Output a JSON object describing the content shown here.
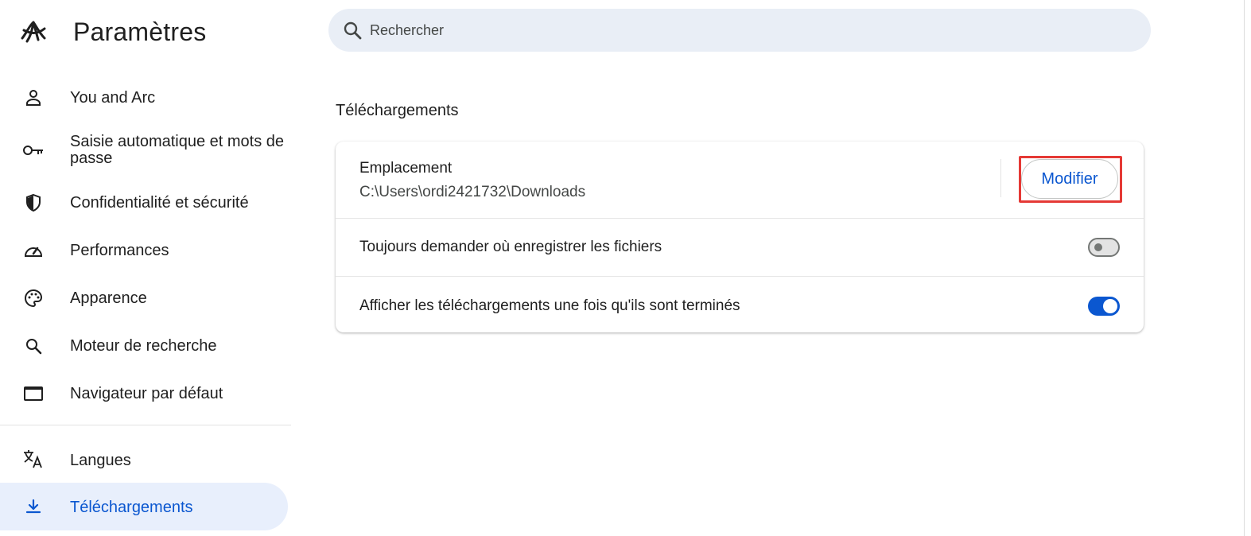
{
  "app": {
    "title": "Paramètres",
    "logo_icon": "arc-logo-icon"
  },
  "search": {
    "placeholder": "Rechercher",
    "icon": "search-icon"
  },
  "sidebar": {
    "items": [
      {
        "label": "You and Arc",
        "icon": "person-icon",
        "active": false
      },
      {
        "label": "Saisie automatique et mots de passe",
        "icon": "key-icon",
        "active": false
      },
      {
        "label": "Confidentialité et sécurité",
        "icon": "shield-icon",
        "active": false
      },
      {
        "label": "Performances",
        "icon": "speedometer-icon",
        "active": false
      },
      {
        "label": "Apparence",
        "icon": "palette-icon",
        "active": false
      },
      {
        "label": "Moteur de recherche",
        "icon": "search-icon",
        "active": false
      },
      {
        "label": "Navigateur par défaut",
        "icon": "browser-window-icon",
        "active": false
      },
      {
        "label": "Langues",
        "icon": "translate-icon",
        "active": false
      },
      {
        "label": "Téléchargements",
        "icon": "download-icon",
        "active": true
      }
    ]
  },
  "main": {
    "section_title": "Téléchargements",
    "location": {
      "label": "Emplacement",
      "value": "C:\\Users\\ordi2421732\\Downloads",
      "button_label": "Modifier"
    },
    "settings": [
      {
        "label": "Toujours demander où enregistrer les fichiers",
        "enabled": false
      },
      {
        "label": "Afficher les téléchargements une fois qu'ils sont terminés",
        "enabled": true
      }
    ]
  },
  "colors": {
    "accent": "#0b57d0",
    "active_nav_bg": "#e8effc",
    "search_bg": "#e9eef6",
    "highlight": "#e53935"
  }
}
